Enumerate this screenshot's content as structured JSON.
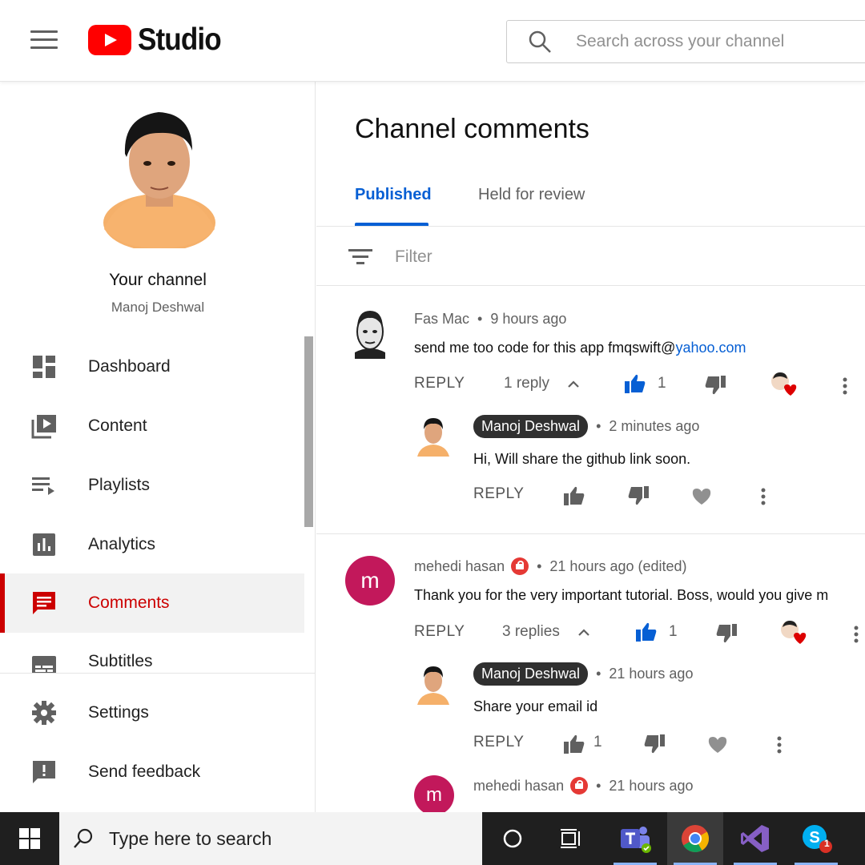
{
  "header": {
    "logo_text": "Studio",
    "search_placeholder": "Search across your channel"
  },
  "sidebar": {
    "channel_label": "Your channel",
    "channel_name": "Manoj Deshwal",
    "items": [
      {
        "label": "Dashboard",
        "icon": "dashboard-icon"
      },
      {
        "label": "Content",
        "icon": "content-icon"
      },
      {
        "label": "Playlists",
        "icon": "playlists-icon"
      },
      {
        "label": "Analytics",
        "icon": "analytics-icon"
      },
      {
        "label": "Comments",
        "icon": "comments-icon",
        "active": true
      },
      {
        "label": "Subtitles",
        "icon": "subtitles-icon"
      }
    ],
    "bottom_items": [
      {
        "label": "Settings",
        "icon": "gear-icon"
      },
      {
        "label": "Send feedback",
        "icon": "feedback-icon"
      }
    ]
  },
  "main": {
    "title": "Channel comments",
    "tabs": [
      {
        "label": "Published",
        "active": true
      },
      {
        "label": "Held for review"
      }
    ],
    "filter_placeholder": "Filter",
    "comments": [
      {
        "author": "Fas Mac",
        "time": "9 hours ago",
        "text": "send me too code for this app fmqswift@",
        "text_link": "yahoo.com",
        "reply_label": "REPLY",
        "replies_label": "1 reply",
        "likes": "1",
        "reply": {
          "author": "Manoj Deshwal",
          "time": "2 minutes ago",
          "text": "Hi, Will share the github link soon.",
          "reply_label": "REPLY"
        }
      },
      {
        "author": "mehedi hasan",
        "avatar_letter": "m",
        "time": "21 hours ago (edited)",
        "text": "Thank you for the very important tutorial. Boss, would you give m",
        "reply_label": "REPLY",
        "replies_label": "3 replies",
        "likes": "1",
        "reply": {
          "author": "Manoj Deshwal",
          "time": "21 hours ago",
          "text": "Share your email id",
          "reply_label": "REPLY",
          "likes": "1"
        },
        "reply2": {
          "author": "mehedi hasan",
          "avatar_letter": "m",
          "time": "21 hours ago"
        }
      }
    ]
  },
  "taskbar": {
    "search_text": "Type here to search",
    "skype_badge": "1"
  },
  "colors": {
    "accent_blue": "#065fd4",
    "active_red": "#cc0000",
    "avatar_pink": "#c2185b"
  }
}
